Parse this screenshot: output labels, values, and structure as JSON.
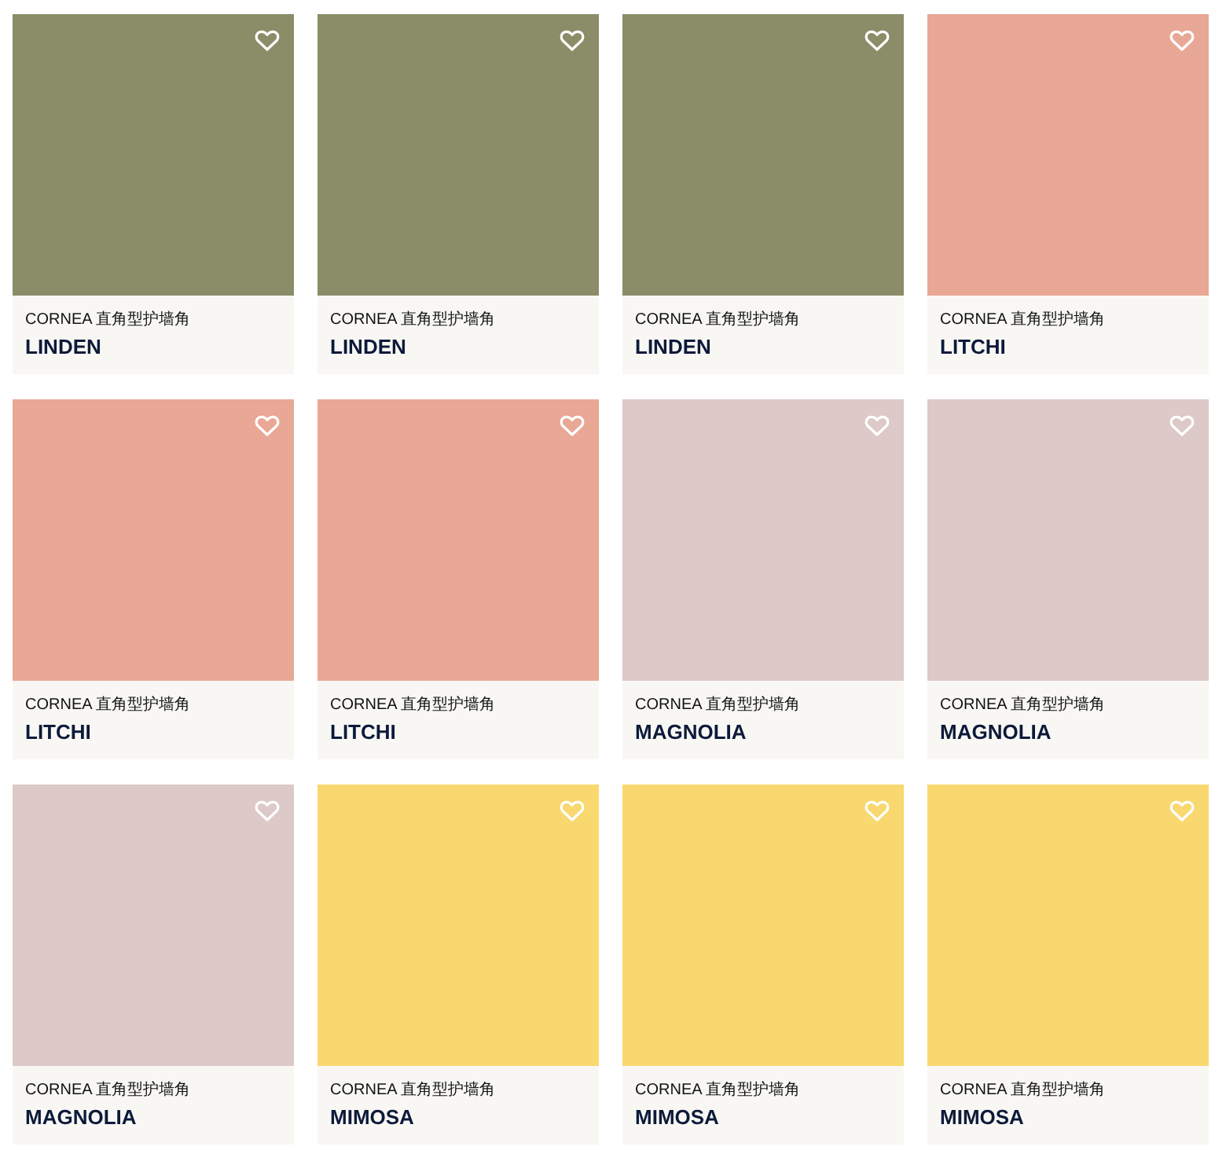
{
  "products": [
    {
      "subtitle": "CORNEA 直角型护墙角",
      "name": "LINDEN",
      "color": "#8a8d67"
    },
    {
      "subtitle": "CORNEA 直角型护墙角",
      "name": "LINDEN",
      "color": "#8a8d67"
    },
    {
      "subtitle": "CORNEA 直角型护墙角",
      "name": "LINDEN",
      "color": "#8a8d67"
    },
    {
      "subtitle": "CORNEA 直角型护墙角",
      "name": "LITCHI",
      "color": "#e9a796"
    },
    {
      "subtitle": "CORNEA 直角型护墙角",
      "name": "LITCHI",
      "color": "#e9a796"
    },
    {
      "subtitle": "CORNEA 直角型护墙角",
      "name": "LITCHI",
      "color": "#e9a796"
    },
    {
      "subtitle": "CORNEA 直角型护墙角",
      "name": "MAGNOLIA",
      "color": "#dcc9c8"
    },
    {
      "subtitle": "CORNEA 直角型护墙角",
      "name": "MAGNOLIA",
      "color": "#dcc9c8"
    },
    {
      "subtitle": "CORNEA 直角型护墙角",
      "name": "MAGNOLIA",
      "color": "#dcc9c8"
    },
    {
      "subtitle": "CORNEA 直角型护墙角",
      "name": "MIMOSA",
      "color": "#f8d86f"
    },
    {
      "subtitle": "CORNEA 直角型护墙角",
      "name": "MIMOSA",
      "color": "#f8d86f"
    },
    {
      "subtitle": "CORNEA 直角型护墙角",
      "name": "MIMOSA",
      "color": "#f8d86f"
    }
  ]
}
